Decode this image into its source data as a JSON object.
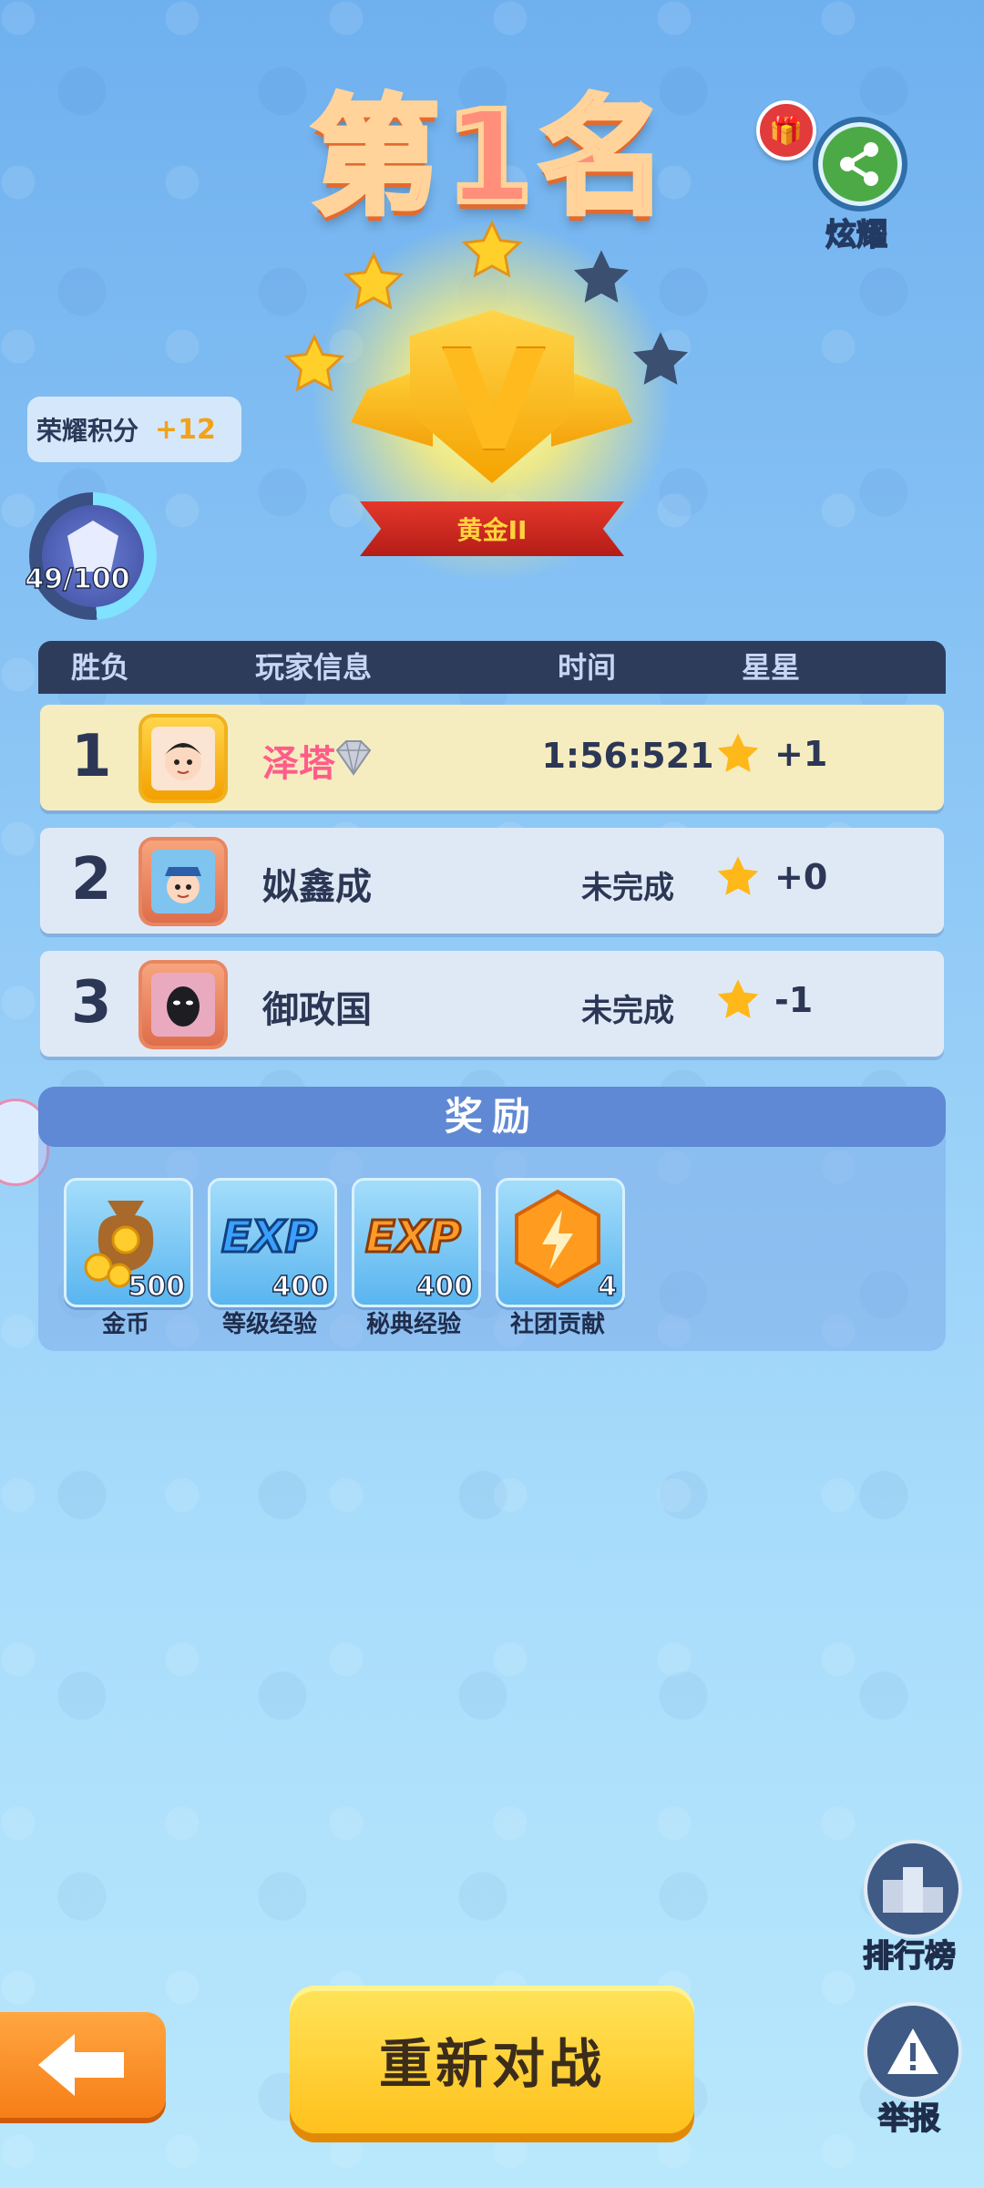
{
  "header": {
    "title": "第1名",
    "share_label": "炫耀"
  },
  "trophy": {
    "tier_label": "黄金II",
    "stars_earned": 3,
    "stars_total": 5
  },
  "honor": {
    "label": "荣耀积分",
    "delta": "+12",
    "progress_text": "49/100",
    "progress_value": 49,
    "progress_max": 100
  },
  "table": {
    "columns": [
      "胜负",
      "玩家信息",
      "时间",
      "星星"
    ],
    "rows": [
      {
        "rank": "1",
        "name": "泽塔",
        "time": "1:56:521",
        "stars": "+1"
      },
      {
        "rank": "2",
        "name": "姒鑫成",
        "time": "未完成",
        "stars": "+0"
      },
      {
        "rank": "3",
        "name": "御政国",
        "time": "未完成",
        "stars": "-1"
      }
    ]
  },
  "rewards": {
    "title": "奖励",
    "items": [
      {
        "name": "金币",
        "qty": "500",
        "icon": "coin-bag-icon"
      },
      {
        "name": "等级经验",
        "qty": "400",
        "icon": "exp-icon"
      },
      {
        "name": "秘典经验",
        "qty": "400",
        "icon": "exp-orange-icon"
      },
      {
        "name": "社团贡献",
        "qty": "4",
        "icon": "lightning-hex-icon"
      }
    ]
  },
  "side": {
    "leaderboard_label": "排行榜",
    "report_label": "举报"
  },
  "footer": {
    "rematch_label": "重新对战"
  },
  "colors": {
    "accent_yellow": "#ffc11c",
    "first_row": "#f5edc0",
    "table_head": "#2e3c5b",
    "pink_name": "#ff5c8a"
  }
}
